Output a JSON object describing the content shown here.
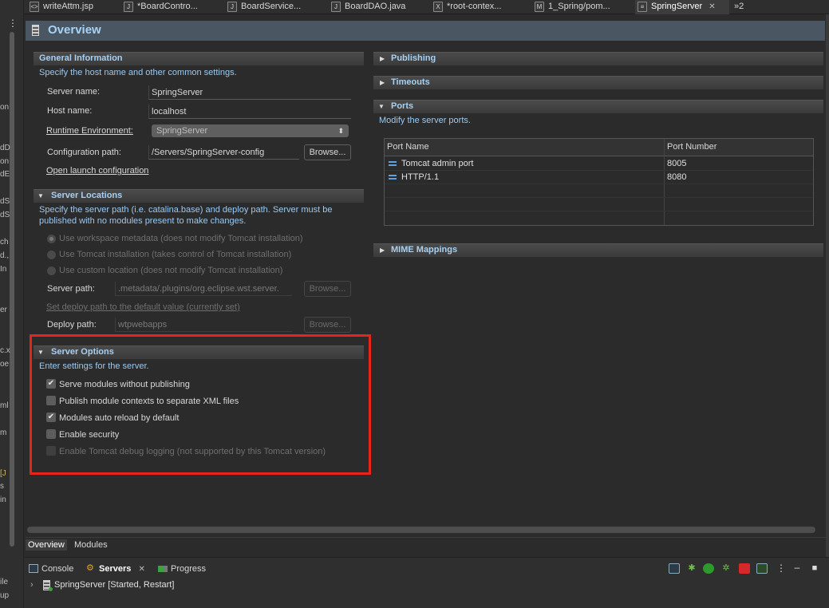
{
  "gutter": {
    "fragments": [
      "on",
      "on",
      "dD",
      "dS",
      "on",
      "dE",
      "dS",
      "dS",
      "ch",
      "d.,",
      "In",
      "er",
      "c.x",
      "oe",
      "ml",
      "m",
      "[J",
      "s",
      "in",
      "ile",
      "up"
    ]
  },
  "tabs": [
    {
      "label": "writeAttm.jsp",
      "icon": "jsp-file-icon"
    },
    {
      "label": "*BoardContro...",
      "icon": "java-file-icon"
    },
    {
      "label": "BoardService...",
      "icon": "java-file-icon"
    },
    {
      "label": "BoardDAO.java",
      "icon": "java-file-icon"
    },
    {
      "label": "*root-contex...",
      "icon": "xml-file-icon"
    },
    {
      "label": "1_Spring/pom...",
      "icon": "maven-file-icon"
    },
    {
      "label": "SpringServer",
      "icon": "server-icon",
      "close": "✕"
    }
  ],
  "tab_overflow": "»2",
  "editor": {
    "title": "Overview",
    "general": {
      "title": "General Information",
      "description": "Specify the host name and other common settings.",
      "server_name_label": "Server name:",
      "server_name_value": "SpringServer",
      "host_name_label": "Host name:",
      "host_name_value": "localhost",
      "runtime_label": "Runtime Environment:",
      "runtime_value": "SpringServer",
      "config_path_label": "Configuration path:",
      "config_path_value": "/Servers/SpringServer-config",
      "browse_label": "Browse...",
      "open_launch_label": "Open launch configuration"
    },
    "locations": {
      "title": "Server Locations",
      "description_line1": "Specify the server path (i.e. catalina.base) and deploy path. Server must be",
      "description_line2": "published with no modules present to make changes.",
      "radio_workspace": "Use workspace metadata (does not modify Tomcat installation)",
      "radio_tomcat": "Use Tomcat installation (takes control of Tomcat installation)",
      "radio_custom": "Use custom location (does not modify Tomcat installation)",
      "server_path_label": "Server path:",
      "server_path_value": ".metadata/.plugins/org.eclipse.wst.server.",
      "browse_label": "Browse...",
      "set_deploy_label": "Set deploy path to the default value (currently set)",
      "deploy_path_label": "Deploy path:",
      "deploy_path_value": "wtpwebapps",
      "browse2_label": "Browse..."
    },
    "options": {
      "title": "Server Options",
      "description": "Enter settings for the server.",
      "items": [
        {
          "label": "Serve modules without publishing",
          "checked": "✔"
        },
        {
          "label": "Publish module contexts to separate XML files",
          "checked": ""
        },
        {
          "label": "Modules auto reload by default",
          "checked": "✔"
        },
        {
          "label": "Enable security",
          "checked": ""
        },
        {
          "label": "Enable Tomcat debug logging (not supported by this Tomcat version)",
          "checked": ""
        }
      ]
    },
    "right": {
      "publishing_title": "Publishing",
      "timeouts_title": "Timeouts",
      "ports_title": "Ports",
      "ports_description": "Modify the server ports.",
      "ports_columns": [
        "Port Name",
        "Port Number"
      ],
      "ports_rows": [
        {
          "name": "Tomcat admin port",
          "number": "8005"
        },
        {
          "name": "HTTP/1.1",
          "number": "8080"
        }
      ],
      "mime_title": "MIME Mappings"
    },
    "bottom_tabs": [
      "Overview",
      "Modules"
    ]
  },
  "bottom_view": {
    "tabs": [
      "Console",
      "Servers",
      "Progress"
    ],
    "servers_close": "✕",
    "server_entry": "SpringServer  [Started, Restart]"
  }
}
